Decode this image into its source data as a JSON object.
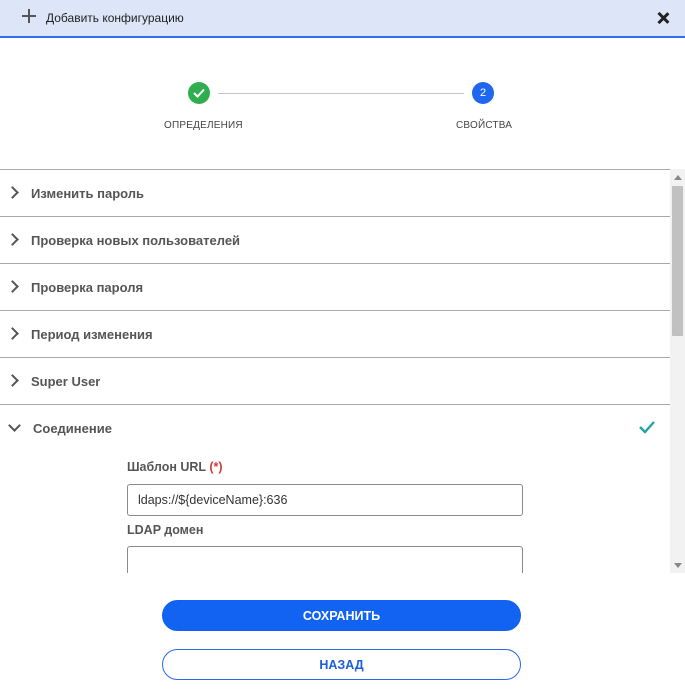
{
  "header": {
    "title": "Добавить конфигурацию"
  },
  "stepper": {
    "steps": [
      {
        "label": "ОПРЕДЕЛЕНИЯ",
        "status": "completed"
      },
      {
        "number": "2",
        "label": "СВОЙСТВА",
        "status": "active"
      }
    ]
  },
  "accordion": {
    "items": [
      {
        "label": "Изменить пароль"
      },
      {
        "label": "Проверка новых пользователей"
      },
      {
        "label": "Проверка пароля"
      },
      {
        "label": "Период изменения"
      },
      {
        "label": "Super User"
      }
    ],
    "open_section": {
      "label": "Соединение",
      "fields": {
        "url_template": {
          "label": "Шаблон URL",
          "required_mark": "(*)",
          "value": "ldaps://${deviceName}:636"
        },
        "ldap_domain": {
          "label": "LDAP домен",
          "value": ""
        }
      }
    }
  },
  "buttons": {
    "save": "СОХРАНИТЬ",
    "back": "НАЗАД"
  },
  "colors": {
    "header_bg": "#dde6f8",
    "accent": "#1263f1",
    "success": "#2fae4f",
    "check_teal": "#1fa3a3",
    "required": "#d03b3b"
  }
}
